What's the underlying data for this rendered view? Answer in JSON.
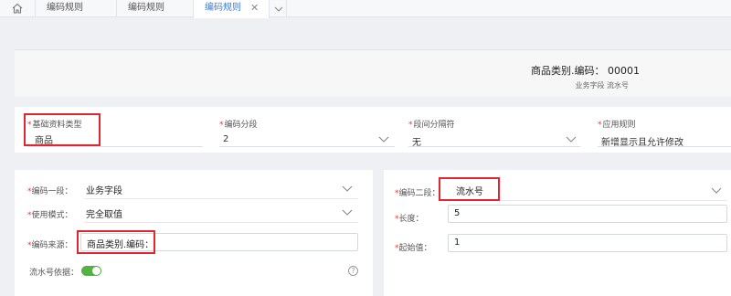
{
  "tabs": [
    {
      "label": "编码规则"
    },
    {
      "label": "编码规则"
    },
    {
      "label": "编码规则",
      "active": true
    }
  ],
  "tab_close": "✕",
  "preview": {
    "code_text": "商品类别.编码： 00001",
    "sub_text": "业务字段 流水号"
  },
  "config": {
    "base_type": {
      "label": "基础资料类型",
      "value": "商品"
    },
    "segment": {
      "label": "编码分段",
      "value": "2"
    },
    "separator": {
      "label": "段间分隔符",
      "value": "无"
    },
    "apply_rule": {
      "label": "应用规则",
      "value": "新增显示且允许修改"
    }
  },
  "left_panel": {
    "seg1": {
      "label": "编码一段：",
      "value": "业务字段"
    },
    "mode": {
      "label": "使用模式：",
      "value": "完全取值"
    },
    "source": {
      "label": "编码来源：",
      "value": "商品类别.编码："
    },
    "serial_basis": {
      "label": "流水号依据：",
      "enabled": true
    },
    "help_glyph": "?"
  },
  "right_panel": {
    "seg2": {
      "label": "编码二段：",
      "value": "流水号"
    },
    "length": {
      "label": "长度：",
      "value": "5"
    },
    "start": {
      "label": "起始值：",
      "value": "1"
    }
  },
  "required_mark": "*",
  "colors": {
    "accent": "#3a7bd5",
    "required": "#e4393c",
    "highlight_box": "#e0272d",
    "toggle_on": "#52b344"
  }
}
